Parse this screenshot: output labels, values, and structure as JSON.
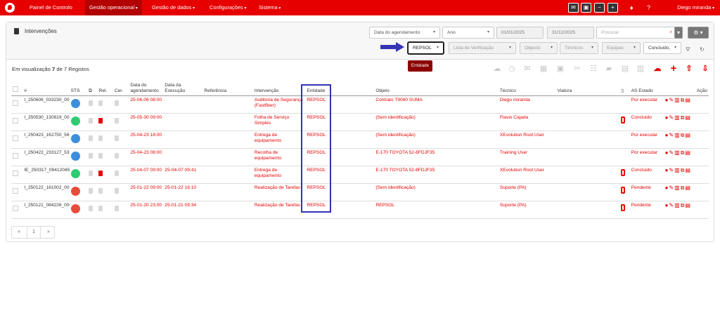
{
  "nav": {
    "items": [
      "Painel de Controlo",
      "Gestão operacional",
      "Gestão de dados",
      "Configurações",
      "Sistema"
    ],
    "active_item": "Gestão operacional",
    "user": "Diego miranda"
  },
  "page": {
    "title": "Intervenções",
    "record_text_before": "Em visualização",
    "record_count": "7",
    "record_text_after": "de 7 Registos"
  },
  "filters": {
    "date_type": "Data do agendamento",
    "period": "Ano",
    "start_date": "01/01/2025",
    "end_date": "31/12/2025",
    "search_placeholder": "Procurar",
    "entity": "REPSOL",
    "checklist": "Lista de Verificação",
    "object": "Objecto",
    "technicians": "Técnicos",
    "teams": "Equipas",
    "status": "Concluido,",
    "tooltip": "Entidade"
  },
  "table": {
    "headers": [
      "#",
      "STS",
      "Rel.",
      "Cer.",
      "Data do agendamento",
      "Data da Execução",
      "Referência",
      "Intervenção",
      "Entidade",
      "Objeto",
      "Técnico",
      "Viatura",
      "AS",
      "Estado",
      "Ação"
    ],
    "rows": [
      {
        "id": "I_250606_033230_0010",
        "status_color": "#3b8edb",
        "schedule": "25-06-06 08:00",
        "execution": "",
        "reference": "",
        "intervention": "Auditoria de Segurança (Fastfiber)",
        "entity": "REPSOL",
        "object": "Contrato T9080 SUMA",
        "technician": "Diego miranda",
        "vehicle": "",
        "state": "Por executar"
      },
      {
        "id": "I_250530_130819_0014",
        "status_color": "#2ecc71",
        "schedule": "25-05-30 09:00",
        "execution": "",
        "reference": "",
        "intervention": "Folha de Serviço Simples",
        "entity": "REPSOL",
        "object": "(Sem identificação)",
        "technician": "Flavio Cajada",
        "vehicle": "",
        "state": "Concluido"
      },
      {
        "id": "I_250423_162750_5660",
        "status_color": "#3b8edb",
        "schedule": "25-04-23 18:00",
        "execution": "",
        "reference": "",
        "intervention": "Entrega de equipamento",
        "entity": "REPSOL",
        "object": "(Sem identificação)",
        "technician": "XEvolution Root User",
        "vehicle": "",
        "state": "Por executar"
      },
      {
        "id": "I_250422_233127_5368",
        "status_color": "#3b8edb",
        "schedule": "25-04-23 08:00",
        "execution": "",
        "reference": "",
        "intervention": "Recolha de equipamento",
        "entity": "REPSOL",
        "object": "E-170 TOYOTA 52-8FDJF35",
        "technician": "Training User",
        "vehicle": "",
        "state": "Por executar"
      },
      {
        "id": "IE_250317_09412045",
        "status_color": "#2ecc71",
        "schedule": "25-04-07 09:00",
        "execution": "25-04-07 09:41",
        "reference": "",
        "intervention": "Entrega de equipamento",
        "entity": "REPSOL",
        "object": "E-170 TOYOTA 52-8FDJF35",
        "technician": "XEvolution Root User",
        "vehicle": "",
        "state": "Concluido"
      },
      {
        "id": "I_250122_161002_0023",
        "status_color": "#e74c3c",
        "schedule": "25-01-22 09:00",
        "execution": "25-01-22 16:10",
        "reference": "",
        "intervention": "Realização de Tarefas",
        "entity": "REPSOL",
        "object": "(Sem identificação)",
        "technician": "Suporte (PA)",
        "vehicle": "",
        "state": "Pendente"
      },
      {
        "id": "I_250121_084226_0008",
        "status_color": "#e74c3c",
        "schedule": "25-01-20 23:00",
        "execution": "25-01-21 09:34",
        "reference": "",
        "intervention": "Realização de Tarefas",
        "entity": "REPSOL",
        "object": "REPSOL",
        "technician": "Suporte (PA)",
        "vehicle": "",
        "state": "Pendente"
      }
    ]
  },
  "pagination": {
    "first": "«",
    "page": "1",
    "last": "»"
  },
  "colors": {
    "brand_red": "#e60000",
    "dark_red": "#b30000",
    "highlight_blue": "#3333b5"
  }
}
